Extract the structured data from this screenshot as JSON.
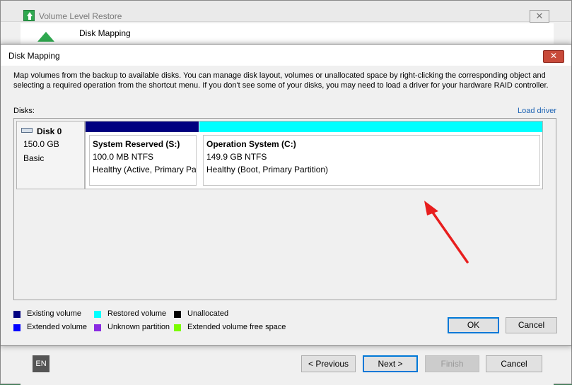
{
  "wizard": {
    "title": "Volume Level Restore",
    "close_label": "✕",
    "step_title": "Disk Mapping",
    "language": "EN",
    "buttons": {
      "previous": "< Previous",
      "next": "Next >",
      "finish": "Finish",
      "cancel": "Cancel"
    }
  },
  "dialog": {
    "title": "Disk Mapping",
    "close_label": "✕",
    "description": "Map volumes from the backup to available disks. You can manage disk layout, volumes or unallocated space by right-clicking the corresponding object and selecting a required operation from the shortcut menu. If you don't see some of your disks, you may need to load a driver for your hardware RAID controller.",
    "disks_label": "Disks:",
    "load_driver_label": "Load driver",
    "disk": {
      "name": "Disk 0",
      "size": "150.0 GB",
      "type": "Basic"
    },
    "volumes": [
      {
        "name": "System Reserved (S:)",
        "fs": "100.0 MB NTFS",
        "status": "Healthy (Active, Primary Pa",
        "color": "#000080"
      },
      {
        "name": "Operation System (C:)",
        "fs": "149.9 GB NTFS",
        "status": "Healthy (Boot, Primary Partition)",
        "color": "#00ffff"
      }
    ],
    "legend": [
      {
        "label": "Existing volume",
        "color": "#000080"
      },
      {
        "label": "Restored volume",
        "color": "#00ffff"
      },
      {
        "label": "Unallocated",
        "color": "#000000"
      },
      {
        "label": "Extended volume",
        "color": "#0000ff"
      },
      {
        "label": "Unknown partition",
        "color": "#8a2be2"
      },
      {
        "label": "Extended volume free space",
        "color": "#7cfc00"
      }
    ],
    "buttons": {
      "ok": "OK",
      "cancel": "Cancel"
    },
    "annotation_color": "#e81e1e"
  }
}
